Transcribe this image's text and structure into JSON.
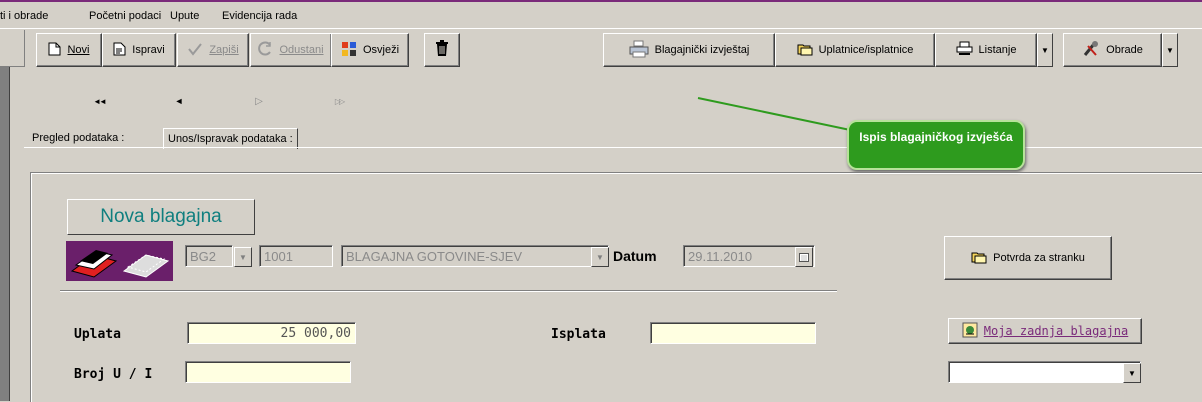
{
  "menu": [
    "ti i obrade",
    "Početni podaci",
    "Upute",
    "Evidencija rada"
  ],
  "toolbar": {
    "novi": "Novi",
    "ispravi": "Ispravi",
    "zapisi": "Zapiši",
    "odustani": "Odustani",
    "osvjezi": "Osvježi",
    "blagajnicki": "Blagajnički izvještaj",
    "uplatnice": "Uplatnice/isplatnice",
    "listanje": "Listanje",
    "obrade": "Obrade"
  },
  "navigator": [
    "◄◄",
    "◄",
    "▷",
    "▷▷"
  ],
  "tabs": [
    "Pregled podataka :",
    "Unos/Ispravak podataka :"
  ],
  "callout": "Ispis blagajničkog izvješća",
  "form": {
    "nova_blagajna": "Nova blagajna",
    "code": "BG2",
    "number": "1001",
    "name": "BLAGAJNA GOTOVINE-SJEV",
    "datum_label": "Datum",
    "datum_value": "29.11.2010",
    "uplata_label": "Uplata",
    "uplata_value": "25 000,00",
    "isplata_label": "Isplata",
    "isplata_value": "",
    "broj_label": "Broj U / I",
    "broj_value": "",
    "potvrda": "Potvrda za stranku",
    "moja": "Moja zadnja blagajna",
    "select_value": ""
  },
  "colors": {
    "accent_purple": "#7a2a7a",
    "callout_green": "#2e9b1e",
    "title_teal": "#0f7f7f"
  }
}
